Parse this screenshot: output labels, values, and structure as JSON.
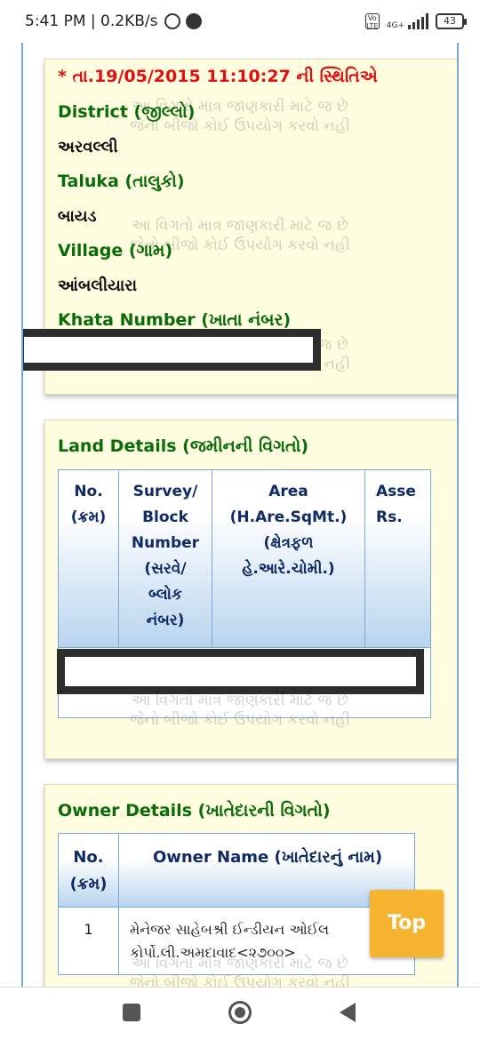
{
  "status_bar": {
    "time": "5:41 PM | 0.2KB/s",
    "network": "4G+",
    "battery": "43"
  },
  "watermark": {
    "line1": "આ વિગતો માત્ર જાણકારી માટે જ છે",
    "line2": "જેનો બીજો કોઈ ઉપયોગ કરવો નહી"
  },
  "record": {
    "as_of": "* તા.19/05/2015 11:10:27 ની સ્થિતિએ",
    "district_label": "District (જીલ્લો)",
    "district_value": "અરવલ્લી",
    "taluka_label": "Taluka (તાલુકો)",
    "taluka_value": "બાયડ",
    "village_label": "Village (ગામ)",
    "village_value": "આંબલીયારા",
    "khata_label": "Khata Number (ખાતા નંબર)"
  },
  "land_details": {
    "title": "Land Details (જમીનની વિગતો)",
    "columns": [
      [
        "No.",
        "(ક્રમ)"
      ],
      [
        "Survey/",
        "Block",
        "Number",
        "(સરવે/",
        "બ્લોક",
        "નંબર)"
      ],
      [
        "Area",
        "(H.Are.SqMt.)",
        "(ક્ષેત્રફળ",
        "હે.આરે.ચોમી.)"
      ],
      [
        "Asse",
        "Rs."
      ]
    ]
  },
  "owner_details": {
    "title": "Owner Details (ખાતેદારની વિગતો)",
    "columns": [
      [
        "No.",
        "(ક્રમ)"
      ],
      [
        "Owner Name (ખાતેદારનું નામ)"
      ]
    ],
    "rows": [
      {
        "no": "1",
        "name_line1": "મેનેજર સાહેબશ્રી ઈન્ડીયન ઓઈલ",
        "name_line2": "કોર્પો.લી.અમદાવાદ<૨૭૦૦>"
      }
    ]
  },
  "top_button": {
    "label": "Top"
  },
  "icons": [
    "whatsapp-icon",
    "chat-icon",
    "signal-icon",
    "battery-icon",
    "recents-icon",
    "home-icon",
    "back-icon"
  ]
}
